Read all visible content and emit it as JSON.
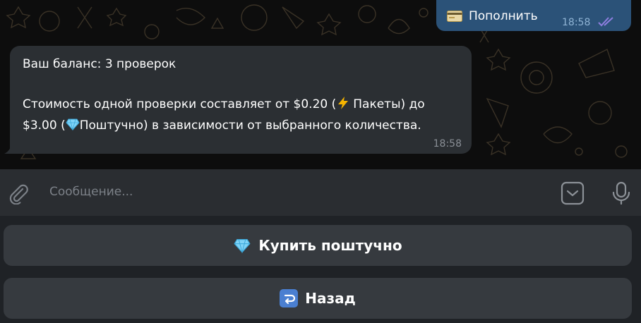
{
  "outgoing": {
    "text": "Пополнить",
    "time": "18:58",
    "icon": "credit-card-icon",
    "status_icon": "double-check-icon"
  },
  "incoming": {
    "line1": "Ваш баланс: 3 проверок",
    "line2_pre": "Стоимость одной проверки составляет от $0.20 (",
    "line2_post": "Пакеты) до",
    "line3_pre": "$3.00 (",
    "line3_post": "Поштучно) в зависимости от выбранного количества.",
    "time": "18:58",
    "icons": [
      "lightning-icon",
      "diamond-icon"
    ]
  },
  "input": {
    "placeholder": "Сообщение..."
  },
  "keyboard": {
    "buttons": [
      {
        "label": "Купить поштучно",
        "icon": "diamond-icon"
      },
      {
        "label": "Назад",
        "icon": "return-arrow-icon"
      }
    ]
  },
  "colors": {
    "background": "#0d0d0d",
    "outgoing_bubble": "#2b5278",
    "incoming_bubble": "#2b2f33",
    "input_bar": "#2a2d31",
    "keyboard_button": "#363a3f",
    "read_check": "#8f7fe0"
  }
}
